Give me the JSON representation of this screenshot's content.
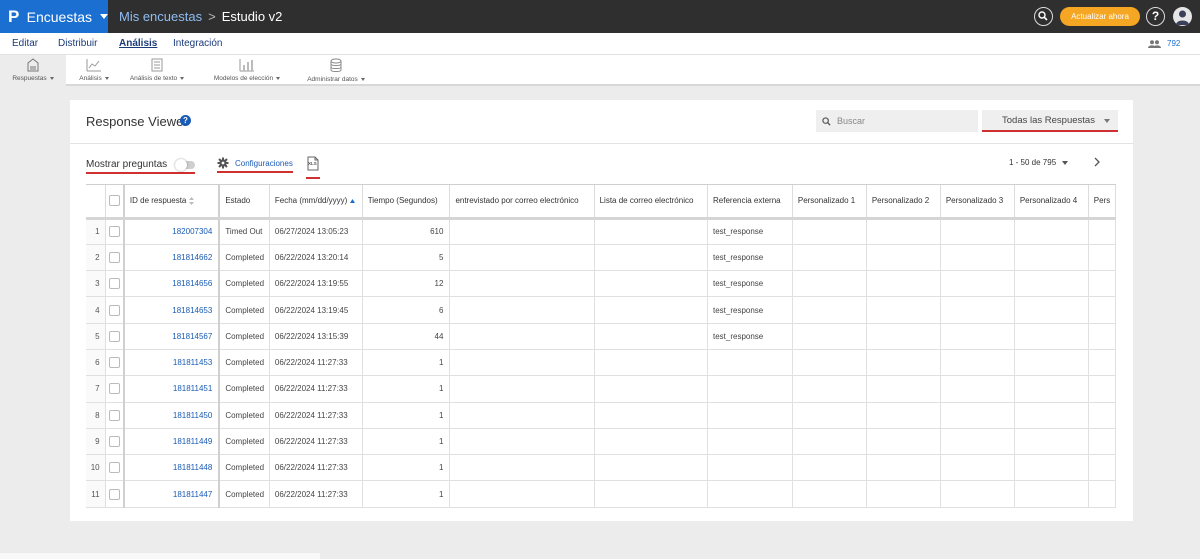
{
  "topbar": {
    "brand": "Encuestas",
    "breadcrumb_parent": "Mis encuestas",
    "breadcrumb_separator": ">",
    "breadcrumb_current": "Estudio v2",
    "upgrade_label": "Actualizar ahora",
    "help_label": "?"
  },
  "nav": {
    "tabs": [
      {
        "label": "Editar"
      },
      {
        "label": "Distribuir"
      },
      {
        "label": "Análisis",
        "active": true
      },
      {
        "label": "Integración"
      }
    ],
    "user_count": "792"
  },
  "toolbar": {
    "items": [
      {
        "label": "Respuestas",
        "icon": "responses-icon",
        "active": true
      },
      {
        "label": "Análisis",
        "icon": "analysis-chart-icon"
      },
      {
        "label": "Análisis de texto",
        "icon": "text-analysis-icon"
      },
      {
        "label": "Modelos de elección",
        "icon": "choice-models-icon"
      },
      {
        "label": "Administrar datos",
        "icon": "database-icon"
      }
    ]
  },
  "viewer": {
    "title": "Response Viewer",
    "search_placeholder": "Buscar",
    "filter_value": "Todas las Respuestas",
    "show_questions_label": "Mostrar preguntas",
    "settings_label": "Configuraciones",
    "export_label": "XLS",
    "pagination": "1 - 50 de 795"
  },
  "table": {
    "columns": [
      "ID de respuesta",
      "Estado",
      "Fecha (mm/dd/yyyy)",
      "Tiempo (Segundos)",
      "entrevistado por correo electrónico",
      "Lista de correo electrónico",
      "Referencia externa",
      "Personalizado 1",
      "Personalizado 2",
      "Personalizado 3",
      "Personalizado 4",
      "Pers"
    ],
    "rows": [
      {
        "n": "1",
        "id": "182007304",
        "status": "Timed Out",
        "date": "06/27/2024 13:05:23",
        "time": "610",
        "email": "",
        "list": "",
        "ref": "test_response"
      },
      {
        "n": "2",
        "id": "181814662",
        "status": "Completed",
        "date": "06/22/2024 13:20:14",
        "time": "5",
        "email": "",
        "list": "",
        "ref": "test_response"
      },
      {
        "n": "3",
        "id": "181814656",
        "status": "Completed",
        "date": "06/22/2024 13:19:55",
        "time": "12",
        "email": "",
        "list": "",
        "ref": "test_response"
      },
      {
        "n": "4",
        "id": "181814653",
        "status": "Completed",
        "date": "06/22/2024 13:19:45",
        "time": "6",
        "email": "",
        "list": "",
        "ref": "test_response"
      },
      {
        "n": "5",
        "id": "181814567",
        "status": "Completed",
        "date": "06/22/2024 13:15:39",
        "time": "44",
        "email": "",
        "list": "",
        "ref": "test_response"
      },
      {
        "n": "6",
        "id": "181811453",
        "status": "Completed",
        "date": "06/22/2024 11:27:33",
        "time": "1",
        "email": "",
        "list": "",
        "ref": ""
      },
      {
        "n": "7",
        "id": "181811451",
        "status": "Completed",
        "date": "06/22/2024 11:27:33",
        "time": "1",
        "email": "",
        "list": "",
        "ref": ""
      },
      {
        "n": "8",
        "id": "181811450",
        "status": "Completed",
        "date": "06/22/2024 11:27:33",
        "time": "1",
        "email": "",
        "list": "",
        "ref": ""
      },
      {
        "n": "9",
        "id": "181811449",
        "status": "Completed",
        "date": "06/22/2024 11:27:33",
        "time": "1",
        "email": "",
        "list": "",
        "ref": ""
      },
      {
        "n": "10",
        "id": "181811448",
        "status": "Completed",
        "date": "06/22/2024 11:27:33",
        "time": "1",
        "email": "",
        "list": "",
        "ref": ""
      },
      {
        "n": "11",
        "id": "181811447",
        "status": "Completed",
        "date": "06/22/2024 11:27:33",
        "time": "1",
        "email": "",
        "list": "",
        "ref": ""
      }
    ]
  },
  "colors": {
    "brand_blue": "#1a6fd1",
    "topbar_bg": "#2f2f2f",
    "upgrade_orange": "#f5a623",
    "link_blue": "#1a5bb5",
    "highlight_red": "#d03030"
  }
}
